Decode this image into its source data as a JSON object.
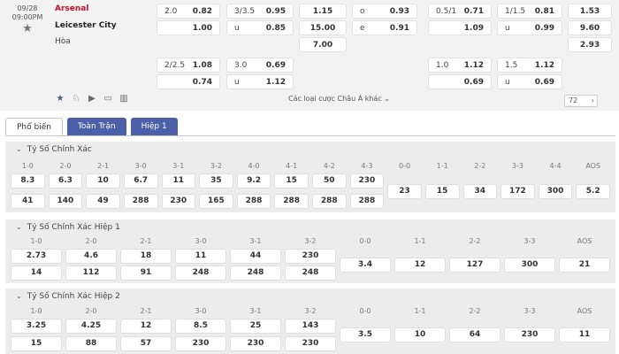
{
  "match": {
    "date": "09/28",
    "time": "09:00PM",
    "home": "Arsenal",
    "away": "Leicester City",
    "draw_label": "Hòa"
  },
  "odds": {
    "hdp1": {
      "line": "2.0",
      "home": "0.82",
      "away": "1.00"
    },
    "ou1": {
      "line": "3/3.5",
      "o": "0.95",
      "u_label": "u",
      "u": "0.85"
    },
    "x12": {
      "home": "1.15",
      "away": "15.00",
      "draw": "7.00"
    },
    "oe": {
      "o_label": "o",
      "o": "0.93",
      "e_label": "e",
      "e": "0.91"
    },
    "hdp1h": {
      "line": "0.5/1",
      "home": "0.71",
      "away": "1.09"
    },
    "ou1h": {
      "line": "1/1.5",
      "o": "0.81",
      "u_label": "u",
      "u": "0.99"
    },
    "x12h": {
      "home": "1.53",
      "away": "9.60",
      "draw": "2.93"
    },
    "hdp2": {
      "line": "2/2.5",
      "home": "1.08",
      "away": "0.74"
    },
    "ou2": {
      "line": "3.0",
      "o": "0.69",
      "u_label": "u",
      "u": "1.12"
    },
    "hdp2h": {
      "line": "1.0",
      "home": "1.12",
      "away": "0.69"
    },
    "ou2h": {
      "line": "1.5",
      "o": "1.12",
      "u_label": "u",
      "u": "0.69"
    }
  },
  "toolbar": {
    "more_label": "Các loại cược Châu Á khác",
    "page_count": "72"
  },
  "tabs": [
    "Phổ biến",
    "Toàn Trận",
    "Hiệp 1"
  ],
  "sections": [
    {
      "title": "Tỷ Số Chính Xác",
      "headers": [
        "1-0",
        "2-0",
        "2-1",
        "3-0",
        "3-1",
        "3-2",
        "4-0",
        "4-1",
        "4-2",
        "4-3",
        "0-0",
        "1-1",
        "2-2",
        "3-3",
        "4-4",
        "AOS"
      ],
      "row1": [
        "8.3",
        "6.3",
        "10",
        "6.7",
        "11",
        "35",
        "9.2",
        "15",
        "50",
        "230"
      ],
      "row2": [
        "41",
        "140",
        "49",
        "288",
        "230",
        "165",
        "288",
        "288",
        "288",
        "288"
      ],
      "draws": [
        "23",
        "15",
        "34",
        "172",
        "300",
        "5.2"
      ]
    },
    {
      "title": "Tỷ Số Chính Xác Hiệp 1",
      "headers": [
        "1-0",
        "2-0",
        "2-1",
        "3-0",
        "3-1",
        "3-2",
        "0-0",
        "1-1",
        "2-2",
        "3-3",
        "AOS"
      ],
      "row1": [
        "2.73",
        "4.6",
        "18",
        "11",
        "44",
        "230"
      ],
      "row2": [
        "14",
        "112",
        "91",
        "248",
        "248",
        "248"
      ],
      "draws": [
        "3.4",
        "12",
        "127",
        "300",
        "21"
      ]
    },
    {
      "title": "Tỷ Số Chính Xác Hiệp 2",
      "headers": [
        "1-0",
        "2-0",
        "2-1",
        "3-0",
        "3-1",
        "3-2",
        "0-0",
        "1-1",
        "2-2",
        "3-3",
        "AOS"
      ],
      "row1": [
        "3.25",
        "4.25",
        "12",
        "8.5",
        "25",
        "143"
      ],
      "row2": [
        "15",
        "88",
        "57",
        "230",
        "230",
        "230"
      ],
      "draws": [
        "3.5",
        "10",
        "64",
        "230",
        "11"
      ]
    }
  ],
  "colors": {
    "tab_active_bg": "#4b60a8",
    "home_team": "#c8102e"
  }
}
